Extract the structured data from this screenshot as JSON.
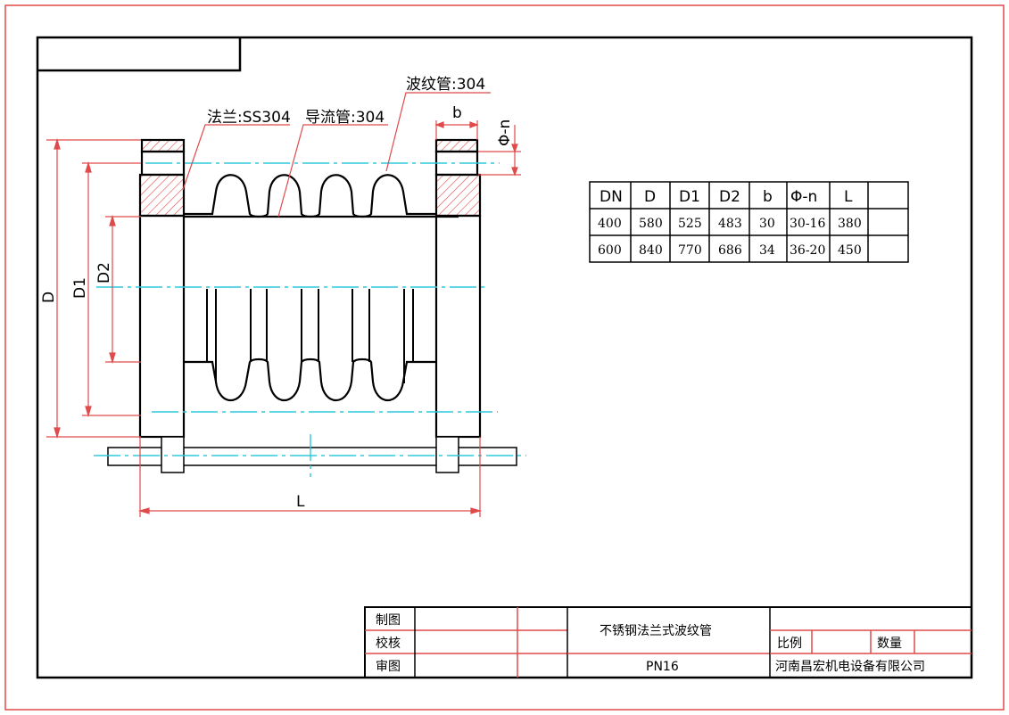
{
  "labels": {
    "flange": "法兰:SS304",
    "guide_tube": "导流管:304",
    "bellows": "波纹管:304",
    "dim_b": "b",
    "dim_phi_n": "Φ-n",
    "dim_D": "D",
    "dim_D1": "D1",
    "dim_D2": "D2",
    "dim_L": "L"
  },
  "spec_table": {
    "headers": [
      "DN",
      "D",
      "D1",
      "D2",
      "b",
      "Φ-n",
      "L",
      ""
    ],
    "rows": [
      [
        "400",
        "580",
        "525",
        "483",
        "30",
        "30-16",
        "380",
        ""
      ],
      [
        "600",
        "840",
        "770",
        "686",
        "34",
        "36-20",
        "450",
        ""
      ]
    ]
  },
  "title_block": {
    "drawn": "制图",
    "checked": "校核",
    "approved": "审图",
    "product_name": "不锈钢法兰式波纹管",
    "pressure": "PN16",
    "scale_label": "比例",
    "quantity_label": "数量",
    "company": "河南昌宏机电设备有限公司"
  },
  "colors": {
    "border_red": "#e04a4a",
    "dim_red": "#e04a4a",
    "center_cyan": "#2ec8dc",
    "line": "#000000"
  }
}
